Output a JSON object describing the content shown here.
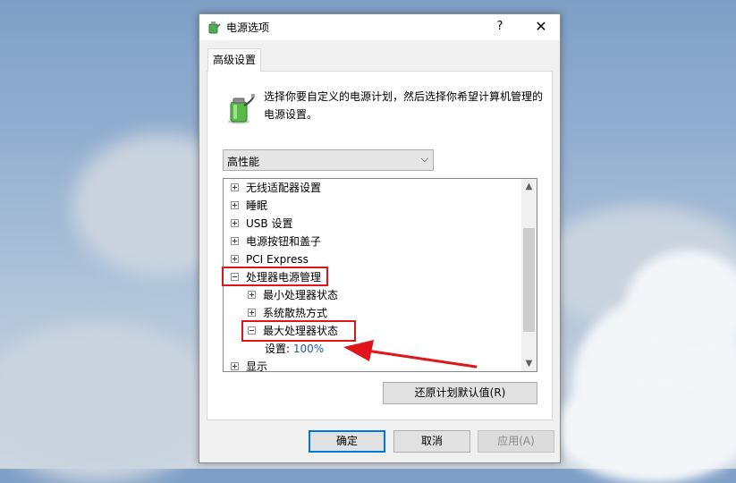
{
  "window": {
    "title": "电源选项",
    "help_glyph": "?",
    "close_glyph": "✕"
  },
  "tabs": [
    {
      "label": "高级设置"
    }
  ],
  "description": "选择你要自定义的电源计划，然后选择你希望计算机管理的电源设置。",
  "plan_select": {
    "value": "高性能",
    "arrow": "⌵"
  },
  "tree": {
    "items": [
      {
        "label": "无线适配器设置",
        "expander": "plus"
      },
      {
        "label": "睡眠",
        "expander": "plus"
      },
      {
        "label": "USB 设置",
        "expander": "plus"
      },
      {
        "label": "电源按钮和盖子",
        "expander": "plus"
      },
      {
        "label": "PCI Express",
        "expander": "plus"
      },
      {
        "label": "处理器电源管理",
        "expander": "minus"
      },
      {
        "label": "最小处理器状态",
        "expander": "plus"
      },
      {
        "label": "系统散热方式",
        "expander": "plus"
      },
      {
        "label": "最大处理器状态",
        "expander": "minus"
      },
      {
        "label": "显示",
        "expander": "plus"
      }
    ],
    "setting": {
      "label": "设置:",
      "value": "100%"
    },
    "scroll_up_glyph": "▲",
    "scroll_down_glyph": "▼"
  },
  "buttons": {
    "restore_defaults": "还原计划默认值(R)",
    "ok": "确定",
    "cancel": "取消",
    "apply": "应用(A)"
  },
  "colors": {
    "highlight": "#e0141b",
    "link_value": "#1e5eb6",
    "accent": "#0078d7"
  }
}
